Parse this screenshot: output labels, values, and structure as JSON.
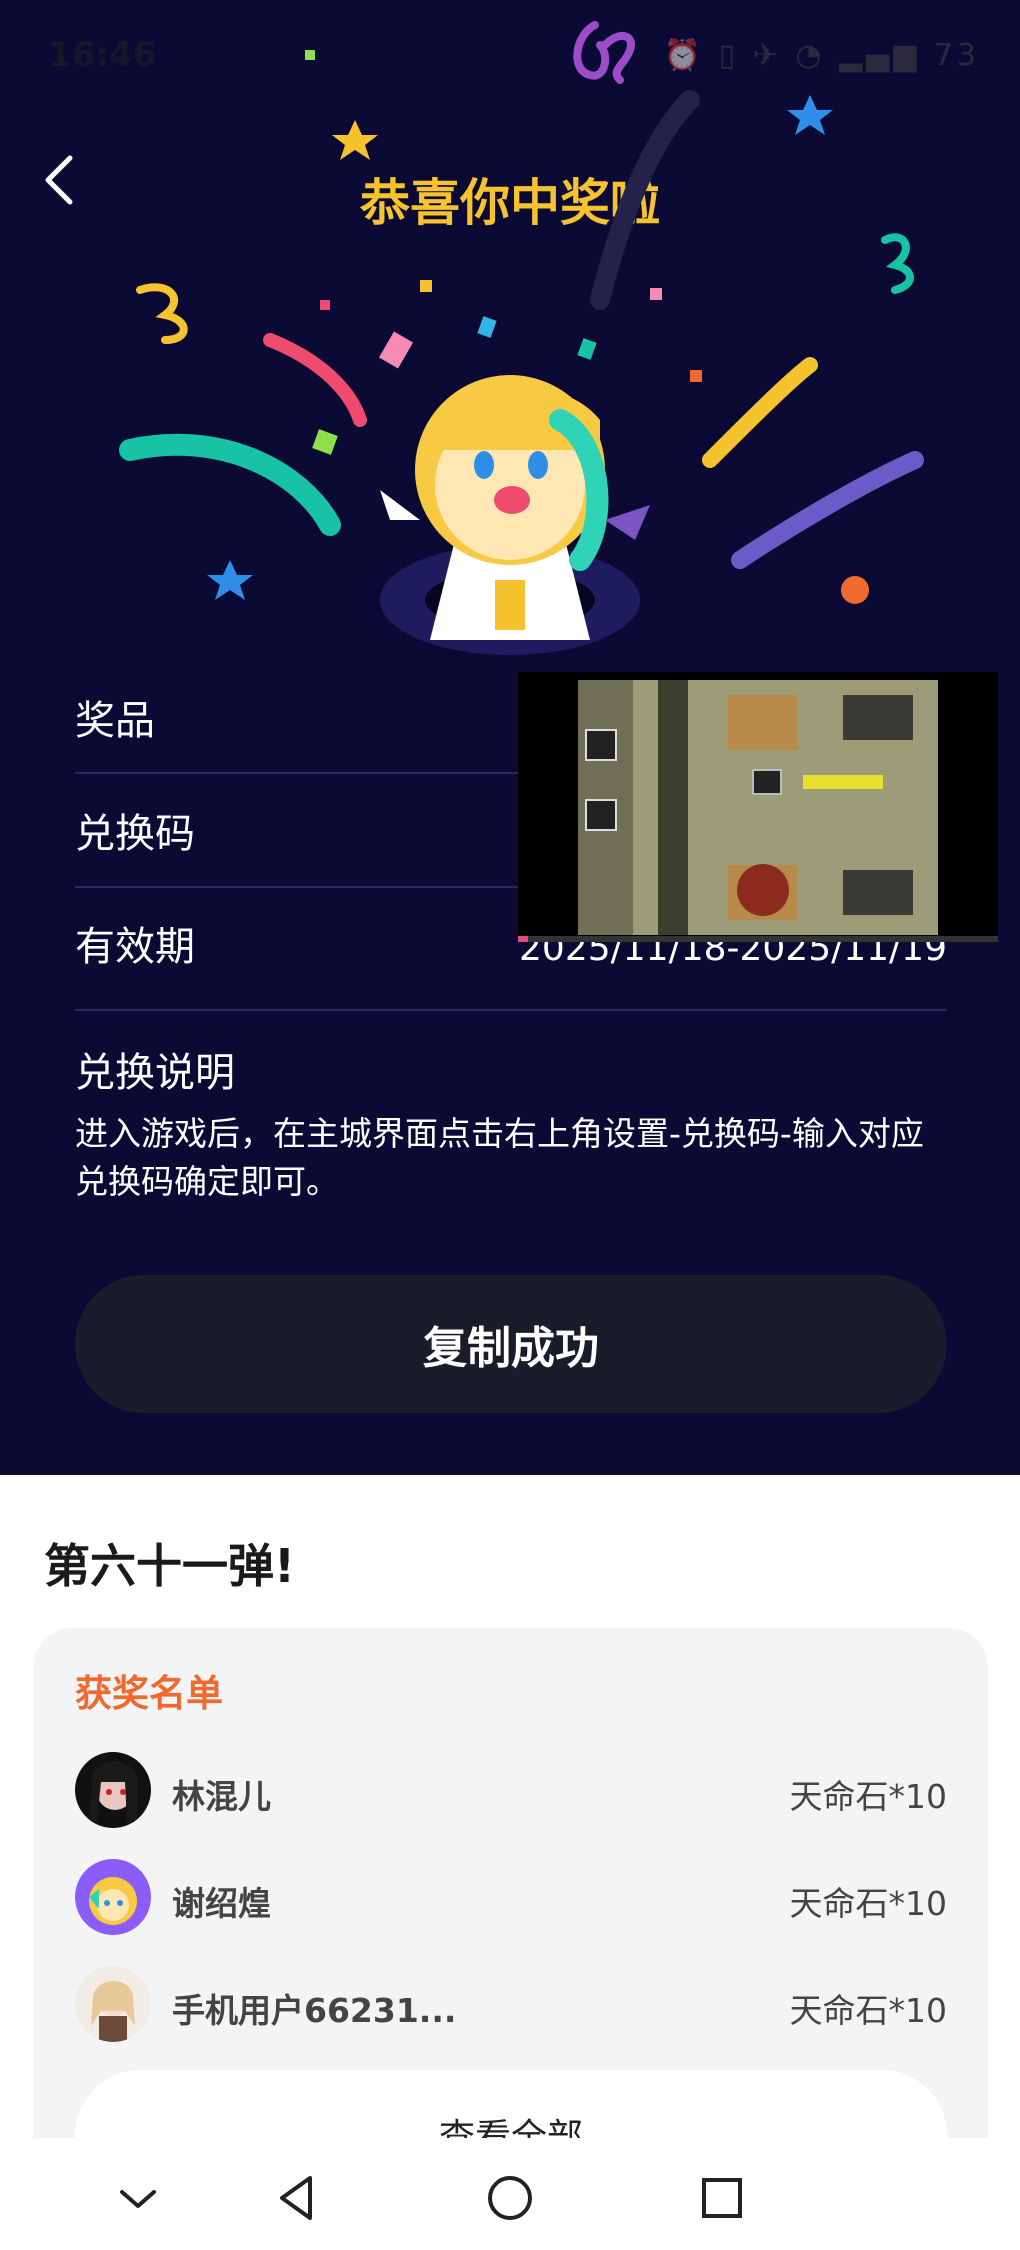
{
  "status_bar": {
    "time": "16:46",
    "icons": "⏰ ▯ ✈ ◔ ▂▄▆ 73"
  },
  "header": {
    "title": "恭喜你中奖啦"
  },
  "details": {
    "prize_label": "奖品",
    "code_label": "兑换码",
    "validity_label": "有效期",
    "validity_value": "2025/11/18-2025/11/19",
    "instructions_label": "兑换说明",
    "instructions_text": "进入游戏后，在主城界面点击右上角设置-兑换码-输入对应兑换码确定即可。"
  },
  "copy_button": {
    "label": "复制成功"
  },
  "video_overlay": {
    "progress_fraction": 0.02
  },
  "round": {
    "title": "第六十一弹!"
  },
  "winners": {
    "title": "获奖名单",
    "items": [
      {
        "name": "林混儿",
        "prize": "天命石*10"
      },
      {
        "name": "谢绍煌",
        "prize": "天命石*10"
      },
      {
        "name": "手机用户66231...",
        "prize": "天命石*10"
      }
    ],
    "view_all": "查看全部"
  },
  "colors": {
    "page_bg": "#0b0a35",
    "title": "#f6c22e",
    "accent": "#f06a2d",
    "button_bg": "#1a1b2b"
  },
  "navigation": {
    "icons": [
      "chevron-down-icon",
      "back-triangle-icon",
      "home-circle-icon",
      "recents-square-icon"
    ]
  }
}
